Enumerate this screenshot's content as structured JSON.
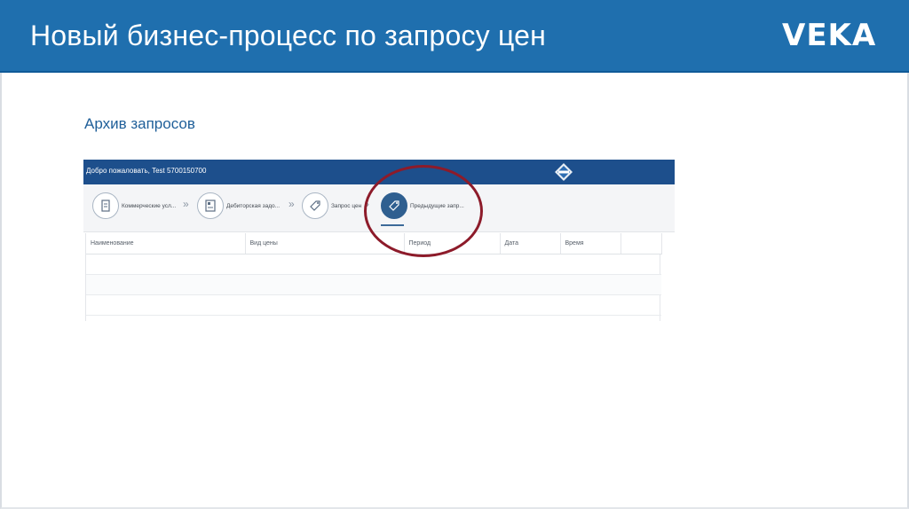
{
  "slide": {
    "title": "Новый бизнес-процесс по запросу цен",
    "logo_text": "VEKA",
    "subtitle": "Архив запросов"
  },
  "app": {
    "welcome_text": "Добро пожаловать, Test 5700150700",
    "logo_icon": "veka-diamond-icon",
    "steps": [
      {
        "label": "Коммерческие усл...",
        "icon": "document-icon"
      },
      {
        "label": "Дебиторская задо...",
        "icon": "ledger-icon"
      },
      {
        "label": "Запрос цен",
        "icon": "price-tag-icon"
      },
      {
        "label": "Предыдущие запр...",
        "icon": "price-tag-icon",
        "active": true
      }
    ],
    "step_separator": "»",
    "table": {
      "columns": [
        "Наименование",
        "Вид цены",
        "Период",
        "Дата",
        "Время",
        ""
      ],
      "rows": [
        [],
        [],
        []
      ]
    }
  },
  "colors": {
    "header_blue": "#1f6fae",
    "app_topbar": "#1d4f8c",
    "ring": "#8d1b2a"
  }
}
